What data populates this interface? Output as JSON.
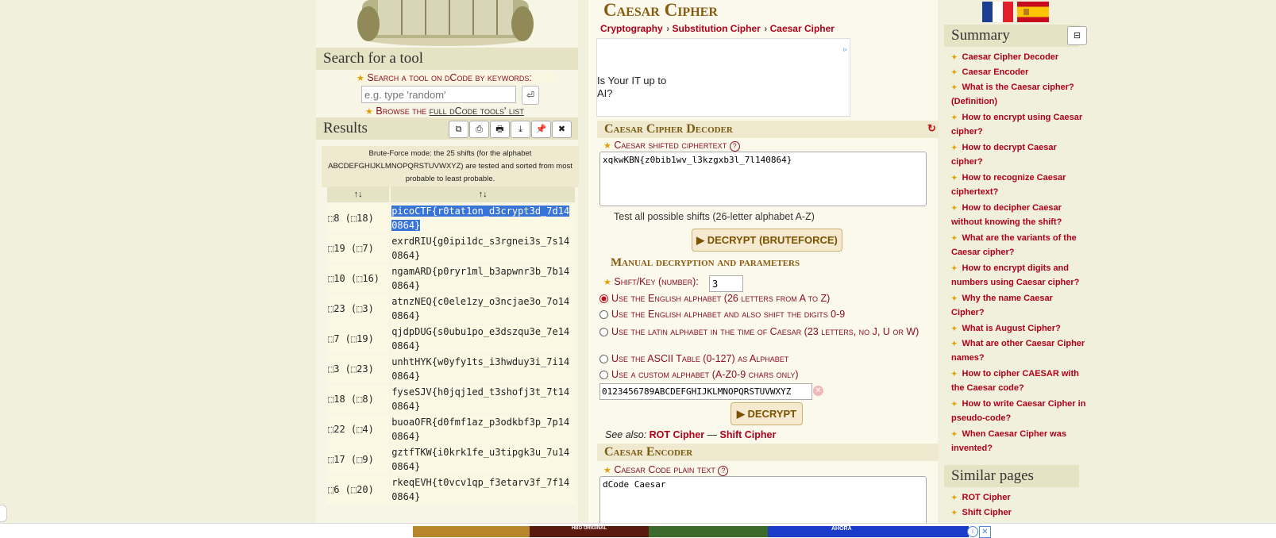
{
  "left": {
    "search_title": "Search for a tool",
    "search_label": "Search a tool on dCode by keywords:",
    "search_placeholder": "e.g. type 'random'",
    "search_go": "⏎",
    "browse_prefix": "Browse the ",
    "browse_link": "full dCode tools' list",
    "results_title": "Results",
    "result_buttons": [
      "⧉",
      "⎙",
      "🖶",
      "⤓",
      "📌",
      "✖"
    ],
    "bruteforce_note": "Brute-Force mode: the 25 shifts (for the alphabet ABCDEFGHIJKLMNOPQRSTUVWXYZ) are tested and sorted from most probable to least probable.",
    "table_headers": [
      "↑↓",
      "↑↓"
    ],
    "rows": [
      {
        "key": "⬚8 (⬚18)",
        "value": "picoCTF{r0tat1on_d3crypt3d_7d140864}"
      },
      {
        "key": "⬚19 (⬚7)",
        "value": "exrdRIU{g0ipi1dc_s3rgnei3s_7s140864}"
      },
      {
        "key": "⬚10 (⬚16)",
        "value": "ngamARD{p0ryr1ml_b3apwnr3b_7b140864}"
      },
      {
        "key": "⬚23 (⬚3)",
        "value": "atnzNEQ{c0ele1zy_o3ncjae3o_7o140864}"
      },
      {
        "key": "⬚7 (⬚19)",
        "value": "qjdpDUG{s0ubu1po_e3dszqu3e_7e140864}"
      },
      {
        "key": "⬚3 (⬚23)",
        "value": "unhtHYK{w0yfy1ts_i3hwduy3i_7i140864}"
      },
      {
        "key": "⬚18 (⬚8)",
        "value": "fyseSJV{h0jqj1ed_t3shofj3t_7t140864}"
      },
      {
        "key": "⬚22 (⬚4)",
        "value": "buoaOFR{d0fmf1az_p3odkbf3p_7p140864}"
      },
      {
        "key": "⬚17 (⬚9)",
        "value": "gztfTKW{i0krk1fe_u3tipgk3u_7u140864}"
      },
      {
        "key": "⬚6 (⬚20)",
        "value": "rkeqEVH{t0vcv1qp_f3etarv3f_7f140864}"
      }
    ]
  },
  "main": {
    "title": "Caesar Cipher",
    "breadcrumb": [
      "Cryptography",
      "Substitution Cipher",
      "Caesar Cipher"
    ],
    "ad_text": "Is Your IT up to AI?",
    "decoder_title": "Caesar Cipher Decoder",
    "ciphertext_label": "Caesar shifted ciphertext",
    "ciphertext_value": "xqkwKBN{z0bib1wv_l3kzgxb3l_7l140864}",
    "test_all_label": "Test all possible shifts (26-letter alphabet A-Z)",
    "bruteforce_button": "▶ DECRYPT (BRUTEFORCE)",
    "manual_title": "Manual decryption and parameters",
    "shift_label": "Shift/Key (number):",
    "shift_value": "3",
    "alphabet_options": [
      "Use the English alphabet (26 letters from A to Z)",
      "Use the English alphabet and also shift the digits 0-9",
      "Use the latin alphabet in the time of Caesar (23 letters, no J, U or W)",
      "Use the ASCII Table (0-127) as Alphabet",
      "Use a custom alphabet (A-Z0-9 chars only)"
    ],
    "custom_alphabet_value": "0123456789ABCDEFGHIJKLMNOPQRSTUVWXYZ",
    "decrypt_button": "▶ DECRYPT",
    "see_also_label": "See also:",
    "see_also_links": [
      "ROT Cipher",
      "Shift Cipher"
    ],
    "see_also_sep": "—",
    "encoder_title": "Caesar Encoder",
    "plaintext_label": "Caesar Code plain text",
    "plaintext_value": "dCode Caesar"
  },
  "right": {
    "summary_title": "Summary",
    "summary_toggle": "⊟",
    "summary_items": [
      "Caesar Cipher Decoder",
      "Caesar Encoder",
      "What is the Caesar cipher? (Definition)",
      "How to encrypt using Caesar cipher?",
      "How to decrypt Caesar cipher?",
      "How to recognize Caesar ciphertext?",
      "How to decipher Caesar without knowing the shift?",
      "What are the variants of the Caesar cipher?",
      "How to encrypt digits and numbers using Caesar cipher?",
      "Why the name Caesar Cipher?",
      "What is August Cipher?",
      "What are other Caesar Cipher names?",
      "How to cipher CAESAR with the Caesar code?",
      "How to write Caesar Cipher in pseudo-code?",
      "When Caesar Cipher was invented?"
    ],
    "similar_title": "Similar pages",
    "similar_items": [
      "ROT Cipher",
      "Shift Cipher"
    ]
  },
  "bottom_ad": {
    "label_hbo": "HBO ORIGINAL",
    "label_ahora": "AHORA"
  },
  "colors": {
    "accent": "#b0001a",
    "title_gold": "#8a5a10",
    "panel_bg": "#e6e2c4",
    "page_bg": "#f1f0dc"
  }
}
